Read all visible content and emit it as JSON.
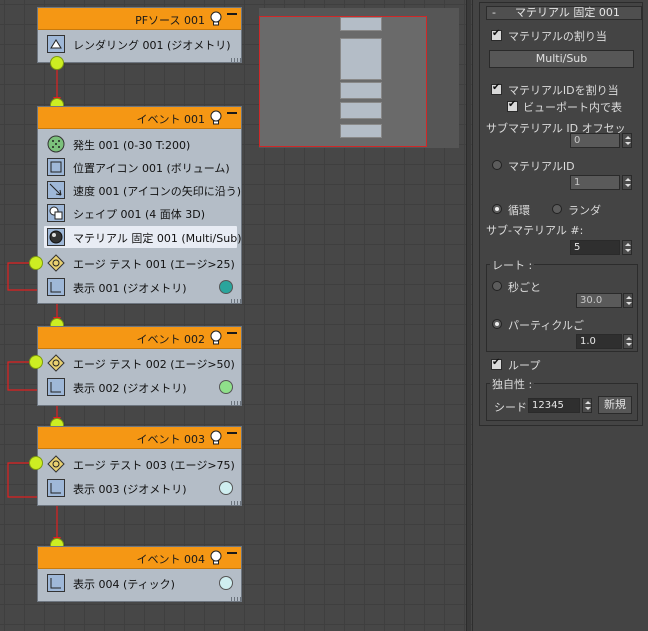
{
  "nodes": [
    {
      "title": "PFソース 001",
      "ops": [
        {
          "label": "レンダリング 001 (ジオメトリ)"
        }
      ]
    },
    {
      "title": "イベント 001",
      "ops": [
        {
          "label": "発生 001 (0-30 T:200)"
        },
        {
          "label": "位置アイコン 001 (ボリューム)"
        },
        {
          "label": "速度 001 (アイコンの矢印に沿う)"
        },
        {
          "label": "シェイプ 001 (4 面体 3D)"
        },
        {
          "label": "マテリアル 固定 001 (Multi/Sub)"
        },
        {
          "label": "エージ テスト 001 (エージ>25)"
        },
        {
          "label": "表示 001 (ジオメトリ)",
          "color": "#2aa59c"
        }
      ]
    },
    {
      "title": "イベント 002",
      "ops": [
        {
          "label": "エージ テスト 002 (エージ>50)"
        },
        {
          "label": "表示 002 (ジオメトリ)",
          "color": "#8fe08a"
        }
      ]
    },
    {
      "title": "イベント 003",
      "ops": [
        {
          "label": "エージ テスト 003 (エージ>75)"
        },
        {
          "label": "表示 003 (ジオメトリ)",
          "color": "#cfeef0"
        }
      ]
    },
    {
      "title": "イベント 004",
      "ops": [
        {
          "label": "表示 004 (ティック)",
          "color": "#cfeef0"
        }
      ]
    }
  ],
  "panel": {
    "rollout_toggle": "-",
    "rollout_title": "マテリアル 固定 001",
    "assign_material_label": "マテリアルの割り当",
    "material_button": "Multi/Sub",
    "assign_material_id_label": "マテリアルIDを割り当",
    "show_in_viewport_label": "ビューポート内で表",
    "sub_material_offset_label": "サブマテリアル ID オフセッ",
    "sub_material_offset_value": "0",
    "material_id_label": "マテリアルID",
    "material_id_value": "1",
    "cycle_label": "循環",
    "random_label": "ランダ",
    "sub_material_num_label": "サブ-マテリアル #:",
    "sub_material_num_value": "5",
    "rate_group_label": "レート :",
    "per_second_label": "秒ごと",
    "per_second_value": "30.0",
    "per_particle_label": "パーティクルご",
    "per_particle_value": "1.0",
    "loop_label": "ループ",
    "uniqueness_group_label": "独自性 :",
    "seed_label": "シード",
    "seed_value": "12345",
    "new_button": "新規"
  },
  "colors": {
    "header": "#f59714",
    "node_body": "#b4bdc7",
    "wire": "#e02020",
    "pin": "#ccee22"
  }
}
